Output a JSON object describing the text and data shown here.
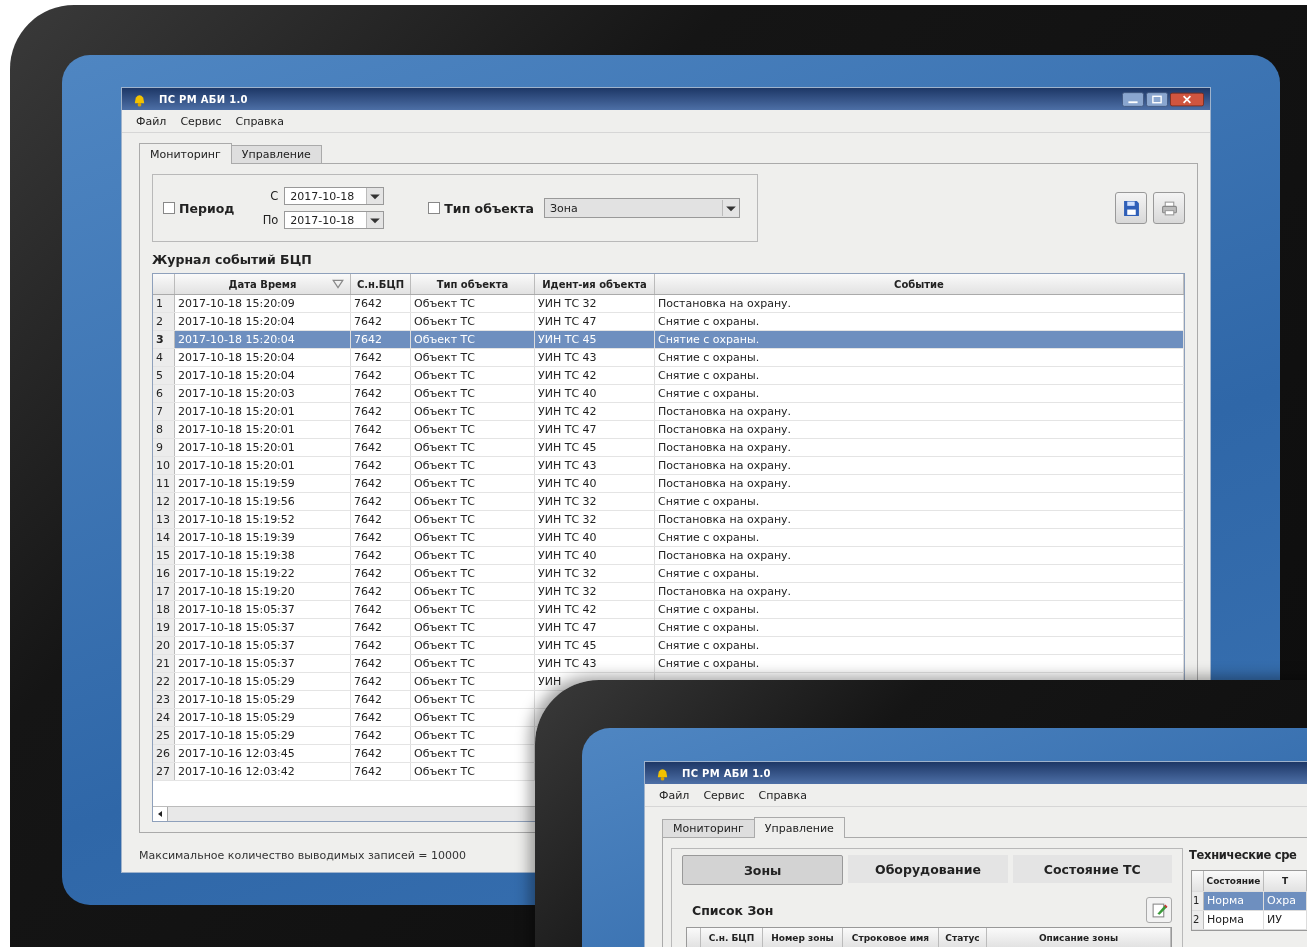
{
  "window": {
    "title": "ПС РМ АБИ 1.0",
    "menu": [
      "Файл",
      "Сервис",
      "Справка"
    ]
  },
  "tabs": [
    {
      "label": "Мониторинг",
      "selected": true
    },
    {
      "label": "Управление",
      "selected": false
    }
  ],
  "filter": {
    "period": {
      "label": "Период",
      "checked": false
    },
    "from_label": "С",
    "from": "2017-10-18",
    "to_label": "По",
    "to": "2017-10-18",
    "object_type": {
      "label": "Тип объекта",
      "checked": false,
      "value": "Зона"
    }
  },
  "journal": {
    "title": "Журнал событий БЦП",
    "columns": [
      "Дата Время",
      "С.н.БЦП",
      "Тип объекта",
      "Идент-ия объекта",
      "Событие"
    ],
    "rows": [
      {
        "n": "1",
        "selected": false,
        "cells": [
          "2017-10-18  15:20:09",
          "7642",
          "Объект ТС",
          "УИН ТС 32",
          "Постановка на охрану."
        ]
      },
      {
        "n": "2",
        "selected": false,
        "cells": [
          "2017-10-18  15:20:04",
          "7642",
          "Объект ТС",
          "УИН ТС 47",
          "Снятие с охраны."
        ]
      },
      {
        "n": "3",
        "selected": true,
        "cells": [
          "2017-10-18  15:20:04",
          "7642",
          "Объект ТС",
          "УИН ТС 45",
          "Снятие с охраны."
        ]
      },
      {
        "n": "4",
        "selected": false,
        "cells": [
          "2017-10-18  15:20:04",
          "7642",
          "Объект ТС",
          "УИН ТС 43",
          "Снятие с охраны."
        ]
      },
      {
        "n": "5",
        "selected": false,
        "cells": [
          "2017-10-18  15:20:04",
          "7642",
          "Объект ТС",
          "УИН ТС 42",
          "Снятие с охраны."
        ]
      },
      {
        "n": "6",
        "selected": false,
        "cells": [
          "2017-10-18  15:20:03",
          "7642",
          "Объект ТС",
          "УИН ТС 40",
          "Снятие с охраны."
        ]
      },
      {
        "n": "7",
        "selected": false,
        "cells": [
          "2017-10-18  15:20:01",
          "7642",
          "Объект ТС",
          "УИН ТС 42",
          "Постановка на охрану."
        ]
      },
      {
        "n": "8",
        "selected": false,
        "cells": [
          "2017-10-18  15:20:01",
          "7642",
          "Объект ТС",
          "УИН ТС 47",
          "Постановка на охрану."
        ]
      },
      {
        "n": "9",
        "selected": false,
        "cells": [
          "2017-10-18  15:20:01",
          "7642",
          "Объект ТС",
          "УИН ТС 45",
          "Постановка на охрану."
        ]
      },
      {
        "n": "10",
        "selected": false,
        "cells": [
          "2017-10-18  15:20:01",
          "7642",
          "Объект ТС",
          "УИН ТС 43",
          "Постановка на охрану."
        ]
      },
      {
        "n": "11",
        "selected": false,
        "cells": [
          "2017-10-18  15:19:59",
          "7642",
          "Объект ТС",
          "УИН ТС 40",
          "Постановка на охрану."
        ]
      },
      {
        "n": "12",
        "selected": false,
        "cells": [
          "2017-10-18  15:19:56",
          "7642",
          "Объект ТС",
          "УИН ТС 32",
          "Снятие с охраны."
        ]
      },
      {
        "n": "13",
        "selected": false,
        "cells": [
          "2017-10-18  15:19:52",
          "7642",
          "Объект ТС",
          "УИН ТС 32",
          "Постановка на охрану."
        ]
      },
      {
        "n": "14",
        "selected": false,
        "cells": [
          "2017-10-18  15:19:39",
          "7642",
          "Объект ТС",
          "УИН ТС 40",
          "Снятие с охраны."
        ]
      },
      {
        "n": "15",
        "selected": false,
        "cells": [
          "2017-10-18  15:19:38",
          "7642",
          "Объект ТС",
          "УИН ТС 40",
          "Постановка на охрану."
        ]
      },
      {
        "n": "16",
        "selected": false,
        "cells": [
          "2017-10-18  15:19:22",
          "7642",
          "Объект ТС",
          "УИН ТС 32",
          "Снятие с охраны."
        ]
      },
      {
        "n": "17",
        "selected": false,
        "cells": [
          "2017-10-18  15:19:20",
          "7642",
          "Объект ТС",
          "УИН ТС 32",
          "Постановка на охрану."
        ]
      },
      {
        "n": "18",
        "selected": false,
        "cells": [
          "2017-10-18  15:05:37",
          "7642",
          "Объект ТС",
          "УИН ТС 42",
          "Снятие с охраны."
        ]
      },
      {
        "n": "19",
        "selected": false,
        "cells": [
          "2017-10-18  15:05:37",
          "7642",
          "Объект ТС",
          "УИН ТС 47",
          "Снятие с охраны."
        ]
      },
      {
        "n": "20",
        "selected": false,
        "cells": [
          "2017-10-18  15:05:37",
          "7642",
          "Объект ТС",
          "УИН ТС 45",
          "Снятие с охраны."
        ]
      },
      {
        "n": "21",
        "selected": false,
        "cells": [
          "2017-10-18  15:05:37",
          "7642",
          "Объект ТС",
          "УИН ТС 43",
          "Снятие с охраны."
        ]
      },
      {
        "n": "22",
        "selected": false,
        "cells": [
          "2017-10-18  15:05:29",
          "7642",
          "Объект ТС",
          "УИН"
        ]
      },
      {
        "n": "23",
        "selected": false,
        "cells": [
          "2017-10-18  15:05:29",
          "7642",
          "Объект ТС"
        ]
      },
      {
        "n": "24",
        "selected": false,
        "cells": [
          "2017-10-18  15:05:29",
          "7642",
          "Объект ТС"
        ]
      },
      {
        "n": "25",
        "selected": false,
        "cells": [
          "2017-10-18  15:05:29",
          "7642",
          "Объект ТС"
        ]
      },
      {
        "n": "26",
        "selected": false,
        "cells": [
          "2017-10-16  12:03:45",
          "7642",
          "Объект ТС"
        ]
      },
      {
        "n": "27",
        "selected": false,
        "cells": [
          "2017-10-16  12:03:42",
          "7642",
          "Объект ТС"
        ]
      }
    ]
  },
  "status_bar": "Максимальное количество выводимых записей = 10000",
  "second_window": {
    "title": "ПС РМ АБИ 1.0",
    "menu": [
      "Файл",
      "Сервис",
      "Справка"
    ],
    "tabs": [
      {
        "label": "Мониторинг",
        "selected": false
      },
      {
        "label": "Управление",
        "selected": true
      }
    ],
    "sections": [
      {
        "label": "Зоны",
        "selected": true
      },
      {
        "label": "Оборудование",
        "selected": false
      },
      {
        "label": "Состояние ТС",
        "selected": false
      }
    ],
    "zones": {
      "title": "Список Зон",
      "columns": [
        "С.н. БЦП",
        "Номер зоны",
        "Строковое имя",
        "Статус",
        "Описание зоны"
      ]
    },
    "tech": {
      "title": "Технические сре",
      "columns": [
        "Состояние",
        "Т"
      ],
      "rows": [
        {
          "n": "1",
          "selected": true,
          "cells": [
            "Норма",
            "Охра"
          ]
        },
        {
          "n": "2",
          "selected": false,
          "cells": [
            "Норма",
            "ИУ"
          ]
        }
      ]
    }
  }
}
